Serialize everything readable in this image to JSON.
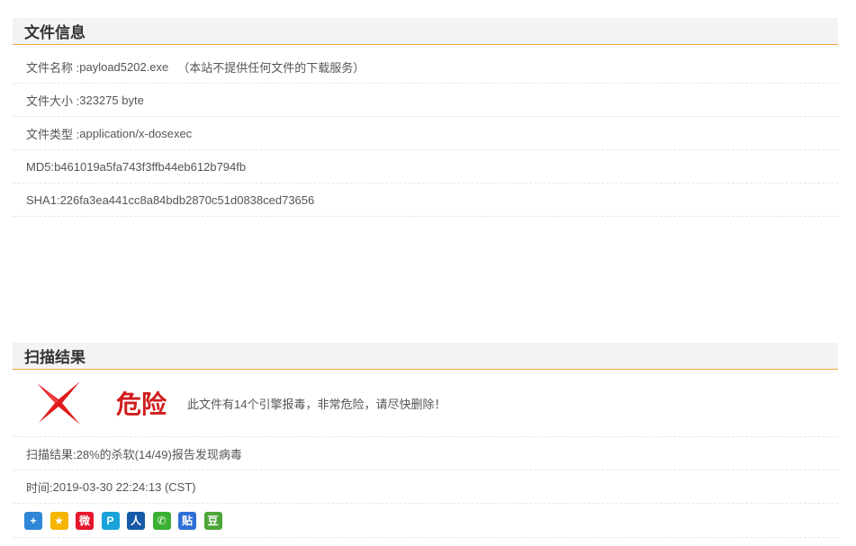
{
  "file_info": {
    "title": "文件信息",
    "name_label": "文件名称 :",
    "name_value": "payload5202.exe",
    "name_note": "（本站不提供任何文件的下载服务）",
    "size_label": "文件大小 :",
    "size_value": "323275 byte",
    "type_label": "文件类型 :",
    "type_value": "application/x-dosexec",
    "md5_label": "MD5:",
    "md5_value": "b461019a5fa743f3ffb44eb612b794fb",
    "sha1_label": "SHA1:",
    "sha1_value": "226fa3ea441cc8a84bdb2870c51d0838ced73656"
  },
  "scan_result": {
    "title": "扫描结果",
    "verdict_icon": "red-x-icon",
    "verdict": "危险",
    "verdict_description": "此文件有14个引擎报毒，非常危险，请尽快删除！",
    "summary": "扫描结果:28%的杀软(14/49)报告发现病毒",
    "time_label": "时间: ",
    "time_value": "2019-03-30 22:24:13 (CST)"
  },
  "share": {
    "icons": [
      {
        "name": "share-more-icon",
        "glyph": "+",
        "color": "#2f87d6"
      },
      {
        "name": "share-qzone-icon",
        "glyph": "★",
        "color": "#f4b400"
      },
      {
        "name": "share-weibo-icon",
        "glyph": "微",
        "color": "#e6162d"
      },
      {
        "name": "share-pengyou-icon",
        "glyph": "P",
        "color": "#1aa3db"
      },
      {
        "name": "share-renren-icon",
        "glyph": "人",
        "color": "#1659a8"
      },
      {
        "name": "share-wechat-icon",
        "glyph": "✆",
        "color": "#3cb034"
      },
      {
        "name": "share-tieba-icon",
        "glyph": "贴",
        "color": "#2f6fd6"
      },
      {
        "name": "share-douban-icon",
        "glyph": "豆",
        "color": "#4da63a"
      }
    ]
  },
  "colors": {
    "header_underline": "#f0a33a",
    "danger": "#d01c1c"
  }
}
